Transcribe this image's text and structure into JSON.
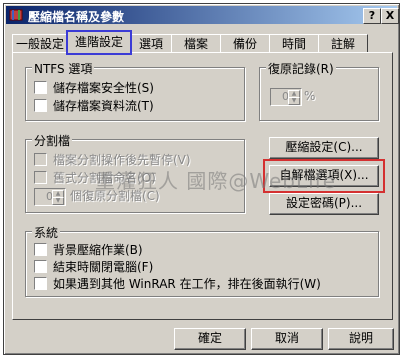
{
  "window": {
    "title": "壓縮檔名稱及參數"
  },
  "titlebar_buttons": {
    "help": "?",
    "close": "X"
  },
  "tabs": [
    {
      "label": "一般設定"
    },
    {
      "label": "進階設定"
    },
    {
      "label": "選項"
    },
    {
      "label": "檔案"
    },
    {
      "label": "備份"
    },
    {
      "label": "時間"
    },
    {
      "label": "註解"
    }
  ],
  "ntfs": {
    "title": "NTFS 選項",
    "items": [
      "儲存檔案安全性(S)",
      "儲存檔案資料流(T)"
    ]
  },
  "recovery": {
    "title": "復原記錄(R)",
    "value": "0",
    "unit": "%"
  },
  "split": {
    "title": "分割檔",
    "items": [
      "檔案分割操作後先暫停(V)",
      "舊式分割檔命名(O)"
    ],
    "spin_value": "0",
    "spin_label": "個復原分割檔(C)"
  },
  "side_buttons": {
    "compression": "壓縮設定(C)...",
    "sfx": "自解檔選項(X)...",
    "password": "設定密碼(P)..."
  },
  "system": {
    "title": "系統",
    "items": [
      "背景壓縮作業(B)",
      "結束時關閉電腦(F)",
      "如果遇到其他 WinRAR 在工作，排在後面執行(W)"
    ]
  },
  "footer": {
    "ok": "確定",
    "cancel": "取消",
    "help": "說明"
  },
  "watermark": "重灌狂人 國際@WebLife",
  "accent": {
    "highlight": "#d43030",
    "active_tab_outline": "#3b3bd6"
  }
}
